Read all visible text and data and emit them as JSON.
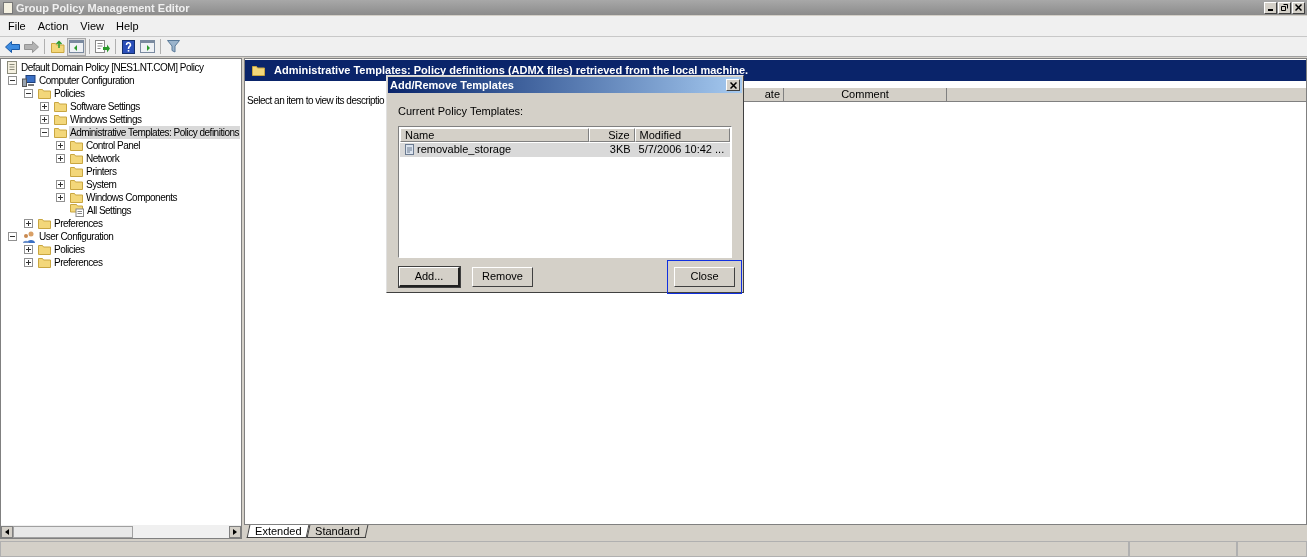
{
  "window": {
    "title": "Group Policy Management Editor"
  },
  "menu": [
    "File",
    "Action",
    "View",
    "Help"
  ],
  "toolbar": [
    {
      "kind": "back",
      "disabled": false
    },
    {
      "kind": "forward",
      "disabled": true
    },
    {
      "kind": "separator"
    },
    {
      "kind": "up",
      "disabled": false
    },
    {
      "kind": "tree",
      "disabled": false,
      "pressed": true
    },
    {
      "kind": "separator"
    },
    {
      "kind": "export",
      "disabled": false
    },
    {
      "kind": "separator"
    },
    {
      "kind": "help",
      "disabled": false
    },
    {
      "kind": "pane",
      "disabled": false,
      "pressed": false
    },
    {
      "kind": "separator"
    },
    {
      "kind": "filter",
      "disabled": false
    }
  ],
  "tree": {
    "label": "Default Domain Policy [NES1.NT.COM] Policy",
    "kind": "policy",
    "selected": false,
    "children": [
      {
        "label": "Computer Configuration",
        "kind": "computer",
        "expanded": true,
        "selected": false,
        "children": [
          {
            "label": "Policies",
            "kind": "folder",
            "expanded": true,
            "selected": false,
            "children": [
              {
                "label": "Software Settings",
                "kind": "folder",
                "expanded": false,
                "selected": false
              },
              {
                "label": "Windows Settings",
                "kind": "folder",
                "expanded": false,
                "selected": false
              },
              {
                "label": "Administrative Templates: Policy definitions",
                "kind": "folder",
                "expanded": true,
                "selected": true,
                "children": [
                  {
                    "label": "Control Panel",
                    "kind": "folder",
                    "expanded": false,
                    "selected": false
                  },
                  {
                    "label": "Network",
                    "kind": "folder",
                    "expanded": false,
                    "selected": false
                  },
                  {
                    "label": "Printers",
                    "kind": "folder",
                    "selected": false
                  },
                  {
                    "label": "System",
                    "kind": "folder",
                    "expanded": false,
                    "selected": false
                  },
                  {
                    "label": "Windows Components",
                    "kind": "folder",
                    "expanded": false,
                    "selected": false
                  },
                  {
                    "label": "All Settings",
                    "kind": "settings",
                    "selected": false
                  }
                ]
              }
            ]
          },
          {
            "label": "Preferences",
            "kind": "folder",
            "expanded": false,
            "selected": false
          }
        ]
      },
      {
        "label": "User Configuration",
        "kind": "user",
        "expanded": true,
        "selected": false,
        "children": [
          {
            "label": "Policies",
            "kind": "folder",
            "expanded": false,
            "selected": false
          },
          {
            "label": "Preferences",
            "kind": "folder",
            "expanded": false,
            "selected": false
          }
        ]
      }
    ]
  },
  "details": {
    "header": "Administrative Templates: Policy definitions (ADMX files) retrieved from the local machine.",
    "description": "Select an item to view its descriptio",
    "columns": [
      "ate",
      "Comment"
    ]
  },
  "tabs": [
    {
      "label": "Extended",
      "selected": true
    },
    {
      "label": "Standard",
      "selected": false
    }
  ],
  "dialog": {
    "title": "Add/Remove Templates",
    "label": "Current Policy Templates:",
    "columns": [
      "Name",
      "Size",
      "Modified"
    ],
    "rows": [
      {
        "name": "removable_storage",
        "size": "3KB",
        "modified": "5/7/2006 10:42 ...",
        "selected": true
      }
    ],
    "buttons": [
      {
        "label": "Add...",
        "default": true,
        "focused": false
      },
      {
        "label": "Remove",
        "default": false,
        "focused": false
      },
      {
        "label": "Close",
        "default": false,
        "focused": true
      }
    ]
  }
}
